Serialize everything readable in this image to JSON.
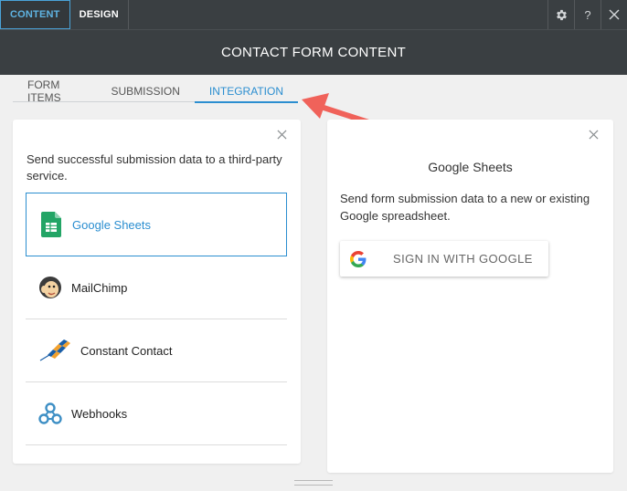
{
  "topbar": {
    "tabs": [
      {
        "label": "CONTENT",
        "active": true
      },
      {
        "label": "DESIGN",
        "active": false
      }
    ],
    "icons": [
      "gear-icon",
      "help-icon",
      "close-icon"
    ],
    "help_label": "?"
  },
  "title": "CONTACT FORM CONTENT",
  "subtabs": [
    {
      "label": "FORM ITEMS",
      "active": false
    },
    {
      "label": "SUBMISSION",
      "active": false
    },
    {
      "label": "INTEGRATION",
      "active": true
    }
  ],
  "left_panel": {
    "intro": "Send successful submission data to a third-party service.",
    "services": [
      {
        "label": "Google Sheets",
        "icon": "google-sheets-icon",
        "selected": true
      },
      {
        "label": "MailChimp",
        "icon": "mailchimp-icon",
        "selected": false
      },
      {
        "label": "Constant Contact",
        "icon": "constant-contact-icon",
        "selected": false
      },
      {
        "label": "Webhooks",
        "icon": "webhooks-icon",
        "selected": false
      }
    ]
  },
  "right_panel": {
    "title": "Google Sheets",
    "description": "Send form submission data to a new or existing Google spreadsheet.",
    "button_label": "SIGN IN WITH GOOGLE"
  },
  "colors": {
    "accent": "#2b8ed0",
    "dark_bar": "#3a3f42",
    "annotation_arrow": "#f0625a"
  }
}
